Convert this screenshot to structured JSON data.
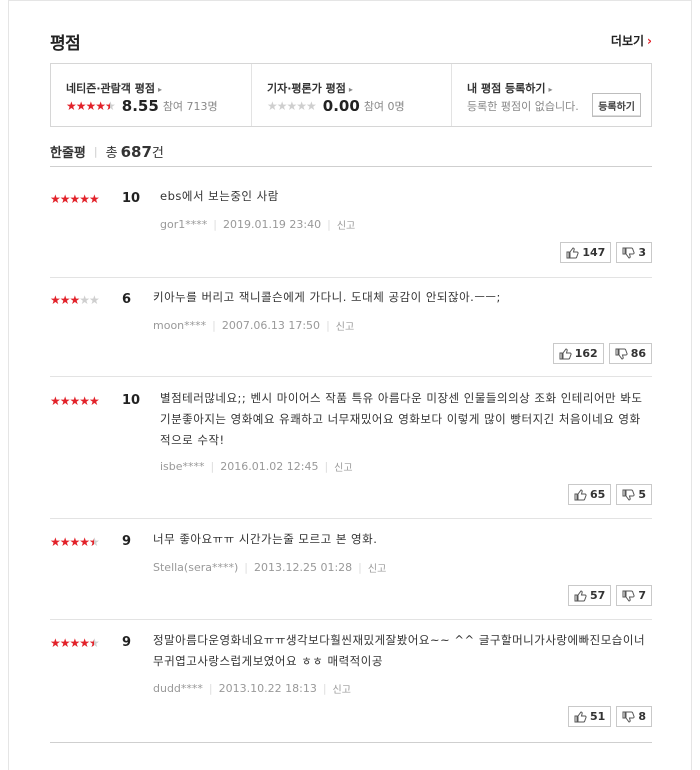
{
  "section": {
    "title": "평점",
    "more_label": "더보기"
  },
  "summary": {
    "netizen": {
      "label": "네티즌·관람객 평점",
      "stars_on": 4,
      "stars_half": 1,
      "stars_off": 0,
      "score": "8.55",
      "participants": "참여 713명"
    },
    "critic": {
      "label": "기자·평론가 평점",
      "stars_on": 0,
      "stars_half": 0,
      "stars_off": 5,
      "score": "0.00",
      "participants": "참여 0명"
    },
    "mine": {
      "label": "내 평점 등록하기",
      "empty_text": "등록한 평점이 없습니다.",
      "register_label": "등록하기"
    }
  },
  "line_reviews": {
    "label": "한줄평",
    "total_prefix": "총",
    "total_count": "687",
    "total_suffix": "건"
  },
  "reviews": [
    {
      "stars": "★★★★★",
      "stars_off": "",
      "score": "10",
      "text": "ebs에서 보는중인 사람",
      "user": "gor1****",
      "date": "2019.01.19 23:40",
      "report": "신고",
      "likes": "147",
      "dislikes": "3"
    },
    {
      "stars": "★★★",
      "stars_off": "★★",
      "score": "6",
      "text": "키아누를 버리고 잭니콜슨에게 가다니. 도대체 공감이 안되잖아.ㅡㅡ;",
      "user": "moon****",
      "date": "2007.06.13 17:50",
      "report": "신고",
      "likes": "162",
      "dislikes": "86"
    },
    {
      "stars": "★★★★★",
      "stars_off": "",
      "score": "10",
      "text": "별점테러많네요;; 벤시 마이어스 작품 특유 아름다운 미장센 인물들의의상 조화 인테리어만 봐도 기분좋아지는 영화예요 유쾌하고 너무재밌어요 영화보다 이렇게 많이 빵터지긴 처음이네요 영화적으로 수작!",
      "user": "isbe****",
      "date": "2016.01.02 12:45",
      "report": "신고",
      "likes": "65",
      "dislikes": "5"
    },
    {
      "stars": "★★★★",
      "stars_off": "",
      "half": true,
      "score": "9",
      "text": "너무 좋아요ㅠㅠ 시간가는줄 모르고 본 영화.",
      "user": "Stella(sera****)",
      "date": "2013.12.25 01:28",
      "report": "신고",
      "likes": "57",
      "dislikes": "7"
    },
    {
      "stars": "★★★★",
      "stars_off": "",
      "half": true,
      "score": "9",
      "text": "정말아름다운영화네요ㅠㅠ생각보다훨씬재밌게잘봤어요~~ ^^ 글구할머니가사랑에빠진모습이너무귀엽고사랑스럽게보였어요 ㅎㅎ 매력적이공",
      "user": "dudd****",
      "date": "2013.10.22 18:13",
      "report": "신고",
      "likes": "51",
      "dislikes": "8"
    }
  ],
  "colors": {
    "accent": "#e2222a",
    "star_off": "#cfcfcf"
  }
}
